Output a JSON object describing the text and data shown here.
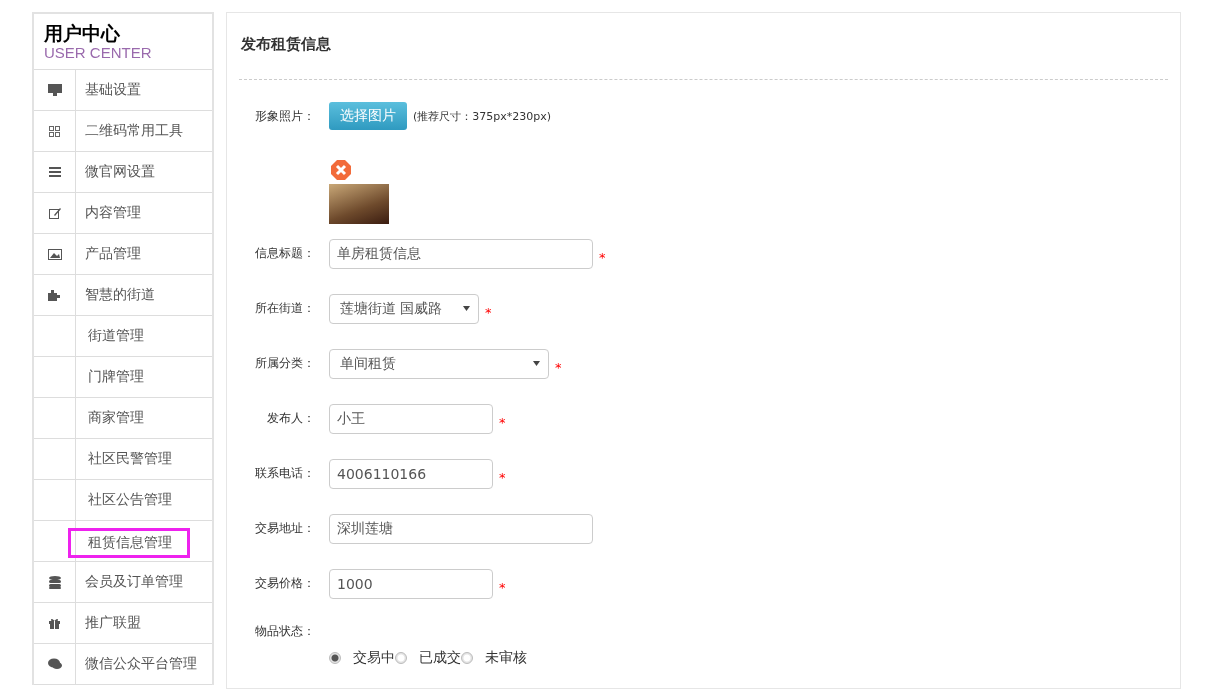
{
  "sidebar": {
    "title": "用户中心",
    "subtitle": "USER CENTER",
    "items": [
      {
        "kind": "main",
        "label": "基础设置",
        "highlighted": false
      },
      {
        "kind": "main",
        "label": "二维码常用工具",
        "highlighted": false
      },
      {
        "kind": "main",
        "label": "微官网设置",
        "highlighted": false
      },
      {
        "kind": "main",
        "label": "内容管理",
        "highlighted": false
      },
      {
        "kind": "main",
        "label": "产品管理",
        "highlighted": false
      },
      {
        "kind": "main",
        "label": "智慧的街道",
        "highlighted": false
      },
      {
        "kind": "sub",
        "label": "街道管理",
        "highlighted": false
      },
      {
        "kind": "sub",
        "label": "门牌管理",
        "highlighted": false
      },
      {
        "kind": "sub",
        "label": "商家管理",
        "highlighted": false
      },
      {
        "kind": "sub",
        "label": "社区民警管理",
        "highlighted": false
      },
      {
        "kind": "sub",
        "label": "社区公告管理",
        "highlighted": false
      },
      {
        "kind": "sub",
        "label": "租赁信息管理",
        "highlighted": true
      },
      {
        "kind": "main",
        "label": "会员及订单管理",
        "highlighted": false
      },
      {
        "kind": "main",
        "label": "推广联盟",
        "highlighted": false
      },
      {
        "kind": "main",
        "label": "微信公众平台管理",
        "highlighted": false
      }
    ]
  },
  "panel": {
    "title": "发布租赁信息",
    "photo": {
      "label": "形象照片：",
      "button": "选择图片",
      "hint": "(推荐尺寸：375px*230px)"
    },
    "fields": [
      {
        "kind": "text",
        "label": "信息标题：",
        "value": "单房租赁信息",
        "required_mark": "*"
      },
      {
        "kind": "select",
        "label": "所在街道：",
        "value": "莲塘街道 国威路",
        "required_mark": "*"
      },
      {
        "kind": "select",
        "label": "所属分类：",
        "value": "单间租赁",
        "required_mark": "*"
      },
      {
        "kind": "text",
        "label": "发布人：",
        "value": "小王",
        "required_mark": "*"
      },
      {
        "kind": "text",
        "label": "联系电话：",
        "value": "4006110166",
        "required_mark": "*"
      },
      {
        "kind": "text",
        "label": "交易地址：",
        "value": "深圳莲塘"
      },
      {
        "kind": "text",
        "label": "交易价格：",
        "value": "1000",
        "required_mark": "*"
      }
    ],
    "status": {
      "label": "物品状态：",
      "options": [
        {
          "label": "交易中",
          "selected": true
        },
        {
          "label": "已成交",
          "selected": false
        },
        {
          "label": "未审核",
          "selected": false
        }
      ]
    }
  }
}
